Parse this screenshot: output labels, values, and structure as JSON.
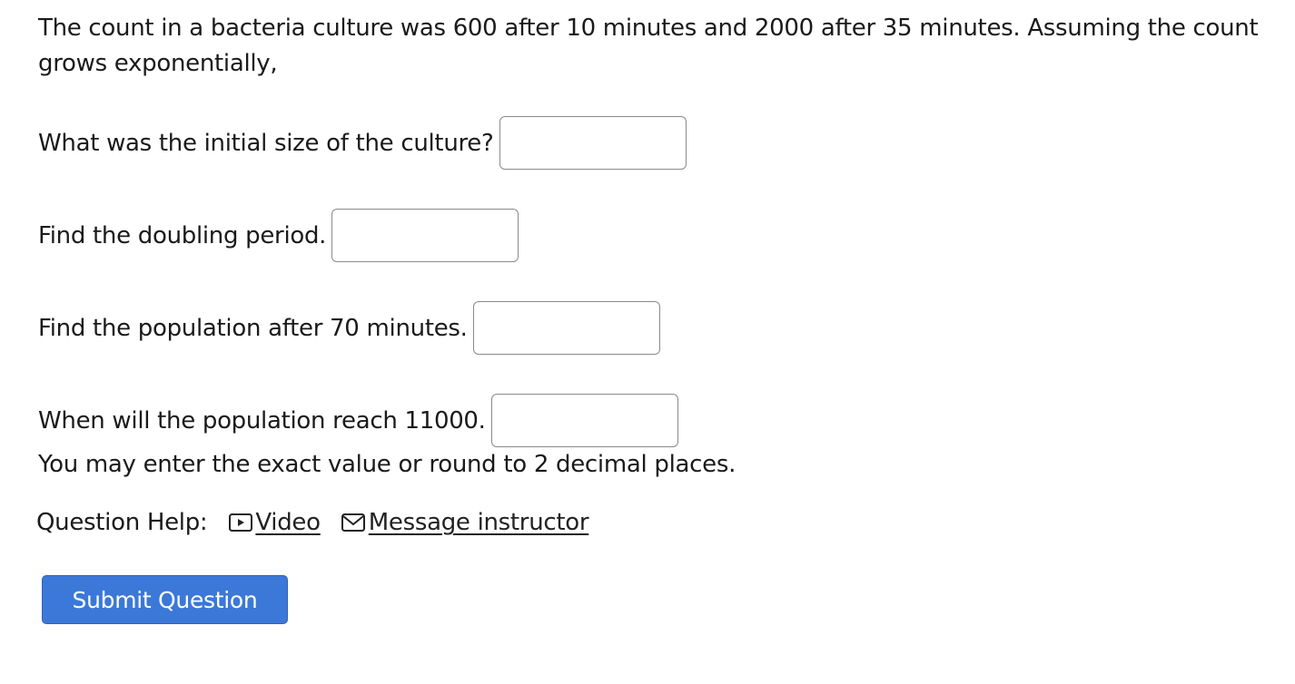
{
  "problem": {
    "intro": "The count in a bacteria culture was 600 after 10 minutes and 2000 after 35 minutes. Assuming the count grows exponentially,"
  },
  "questions": [
    {
      "label": "What was the initial size of the culture?",
      "value": ""
    },
    {
      "label": "Find the doubling period.",
      "value": ""
    },
    {
      "label": "Find the population after 70 minutes.",
      "value": ""
    },
    {
      "label": "When will the population reach 11000.",
      "value": ""
    }
  ],
  "note": "You may enter the exact value or round to 2 decimal places.",
  "help": {
    "label": "Question Help:",
    "video_label": "Video",
    "video_icon": "play-video-icon",
    "message_label": "Message instructor",
    "message_icon": "envelope-icon"
  },
  "submit": {
    "label": "Submit Question",
    "color": "#3b78d8"
  }
}
